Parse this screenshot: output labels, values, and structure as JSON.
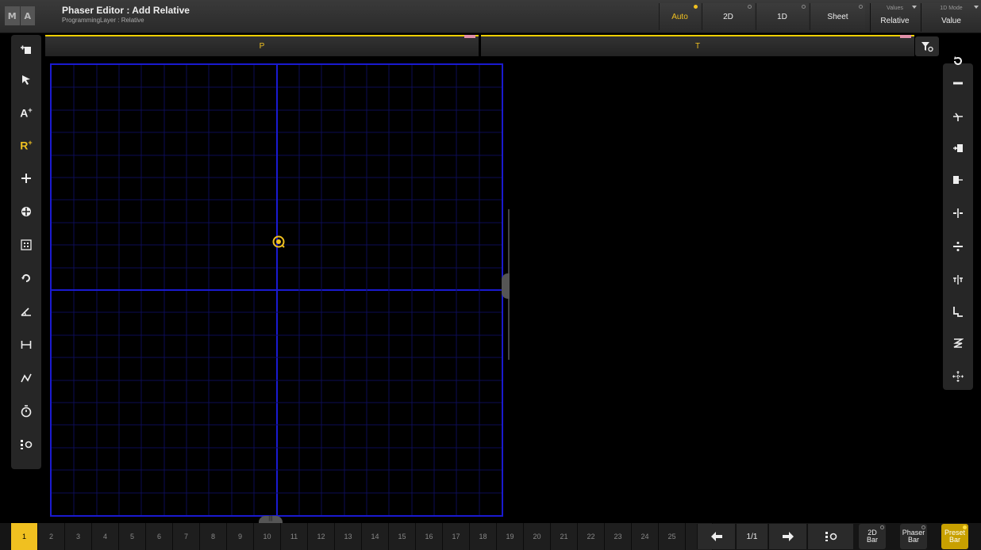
{
  "logo": {
    "left": "M",
    "right": "A"
  },
  "window": {
    "title": "Phaser Editor : Add Relative",
    "subtitle": "ProgrammingLayer : Relative"
  },
  "modes": {
    "auto": "Auto",
    "two_d": "2D",
    "one_d": "1D",
    "sheet": "Sheet",
    "active": "Auto"
  },
  "values_select": {
    "caption": "Values",
    "value": "Relative"
  },
  "mode_1d_select": {
    "caption": "1D Mode",
    "value": "Value"
  },
  "axes": {
    "left": "P",
    "right": "T"
  },
  "left_tools": [
    {
      "icon": "add-step-icon"
    },
    {
      "icon": "select-arrow-icon"
    },
    {
      "icon": "absolute-add-icon",
      "label": "A+"
    },
    {
      "icon": "relative-add-icon",
      "label": "R+",
      "active": true
    },
    {
      "icon": "move-icon"
    },
    {
      "icon": "center-icon"
    },
    {
      "icon": "grid-snap-icon"
    },
    {
      "icon": "rotate-icon"
    },
    {
      "icon": "angle-icon"
    },
    {
      "icon": "width-icon"
    },
    {
      "icon": "transition-icon"
    },
    {
      "icon": "timer-icon"
    },
    {
      "icon": "list-settings-icon"
    }
  ],
  "right_tools": [
    {
      "icon": "reset-icon"
    },
    {
      "icon": "minus-icon"
    },
    {
      "icon": "insert-icon"
    },
    {
      "icon": "align-left-icon"
    },
    {
      "icon": "align-right-icon"
    },
    {
      "icon": "split-icon"
    },
    {
      "icon": "divide-icon"
    },
    {
      "icon": "mirror-icon"
    },
    {
      "icon": "step-icon"
    },
    {
      "icon": "spread-icon"
    },
    {
      "icon": "move-all-icon"
    }
  ],
  "pages": [
    "1",
    "2",
    "3",
    "4",
    "5",
    "6",
    "7",
    "8",
    "9",
    "10",
    "11",
    "12",
    "13",
    "14",
    "15",
    "16",
    "17",
    "18",
    "19",
    "20",
    "21",
    "22",
    "23",
    "24",
    "25",
    "2"
  ],
  "active_page": "1",
  "page_indicator": "1/1",
  "bottom_buttons": {
    "bar_2d": "2D Bar",
    "phaser_bar": "Phaser Bar",
    "preset_bar": "Preset Bar"
  },
  "colors": {
    "accent": "#f0c020",
    "grid_line": "#1a1ad0",
    "grid_minor": "#0d0d55"
  }
}
